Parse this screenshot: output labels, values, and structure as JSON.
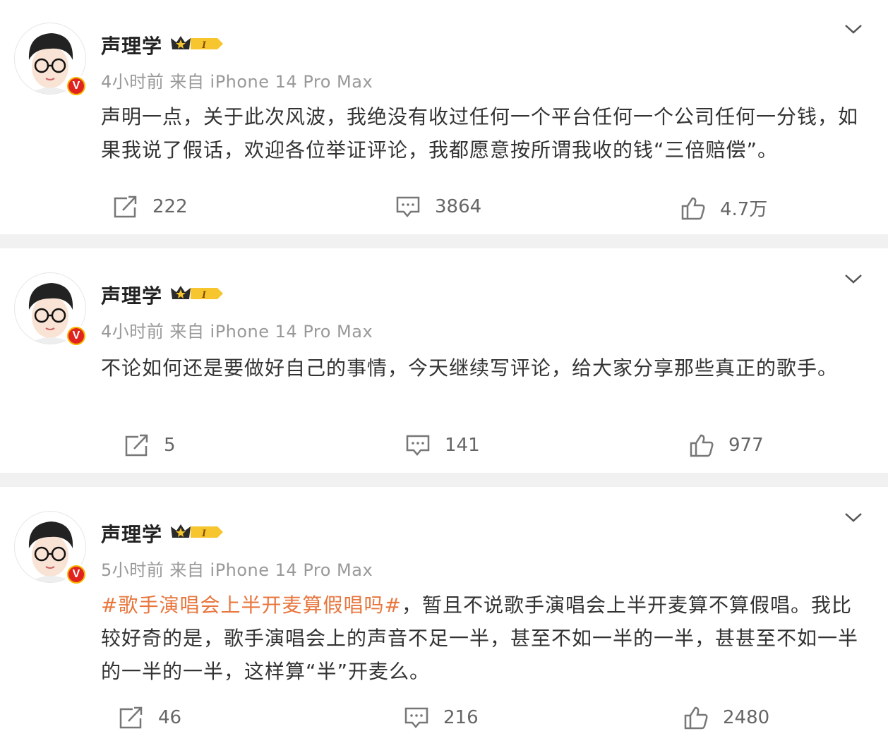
{
  "colors": {
    "topic": "#e8763d",
    "meta": "#999999",
    "badge_gold": "#f7b400",
    "badge_red": "#e0231f"
  },
  "badges": {
    "verified_letter": "V",
    "vip_level": "I"
  },
  "posts": [
    {
      "author": "声理学",
      "meta": "4小时前  来自 iPhone 14 Pro Max",
      "topic": "",
      "text": "声明一点，关于此次风波，我绝没有收过任何一个平台任何一个公司任何一分钱，如果我说了假话，欢迎各位举证评论，我都愿意按所谓我收的钱“三倍赔偿”。",
      "reposts": "222",
      "comments": "3864",
      "likes": "4.7万"
    },
    {
      "author": "声理学",
      "meta": "4小时前  来自 iPhone 14 Pro Max",
      "topic": "",
      "text": "不论如何还是要做好自己的事情，今天继续写评论，给大家分享那些真正的歌手。",
      "reposts": "5",
      "comments": "141",
      "likes": "977"
    },
    {
      "author": "声理学",
      "meta": "5小时前  来自 iPhone 14 Pro Max",
      "topic": "#歌手演唱会上半开麦算假唱吗#",
      "text": "，暂且不说歌手演唱会上半开麦算不算假唱。我比较好奇的是，歌手演唱会上的声音不足一半，甚至不如一半的一半，甚甚至不如一半的一半的一半，这样算“半”开麦么。",
      "reposts": "46",
      "comments": "216",
      "likes": "2480"
    }
  ]
}
